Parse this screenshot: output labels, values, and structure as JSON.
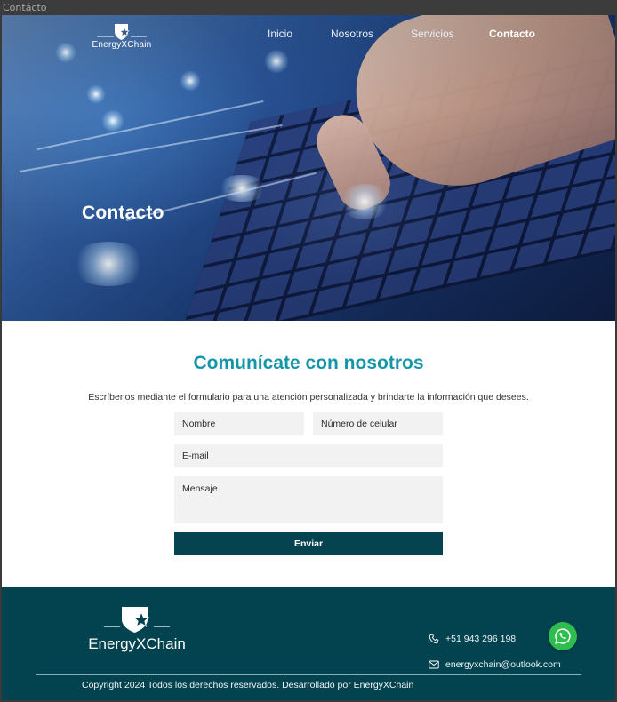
{
  "window": {
    "title": "Contácto"
  },
  "brand": {
    "name": "EnergyXChain"
  },
  "nav": {
    "items": [
      {
        "label": "Inicio",
        "active": false
      },
      {
        "label": "Nosotros",
        "active": false
      },
      {
        "label": "Servicios",
        "active": false
      },
      {
        "label": "Contacto",
        "active": true
      }
    ]
  },
  "hero": {
    "title": "Contacto"
  },
  "contact": {
    "heading": "Comunícate con nosotros",
    "description": "Escríbenos mediante el formulario para una atención personalizada y brindarte la información que desees.",
    "fields": {
      "name_placeholder": "Nombre",
      "phone_placeholder": "Número de celular",
      "email_placeholder": "E-mail",
      "message_placeholder": "Mensaje"
    },
    "submit_label": "Enviar"
  },
  "footer": {
    "phone": "+51 943 296 198",
    "email": "energyxchain@outlook.com",
    "copyright": "Copyright 2024 Todos los derechos reservados. Desarrollado por EnergyXChain"
  },
  "colors": {
    "accent_teal": "#1596a8",
    "dark_teal": "#03434f",
    "button": "#04434f",
    "whatsapp": "#2fbd4f",
    "field_bg": "#f2f2f2"
  },
  "icons": [
    "shield-star-logo-icon",
    "phone-icon",
    "mail-icon",
    "whatsapp-icon"
  ]
}
